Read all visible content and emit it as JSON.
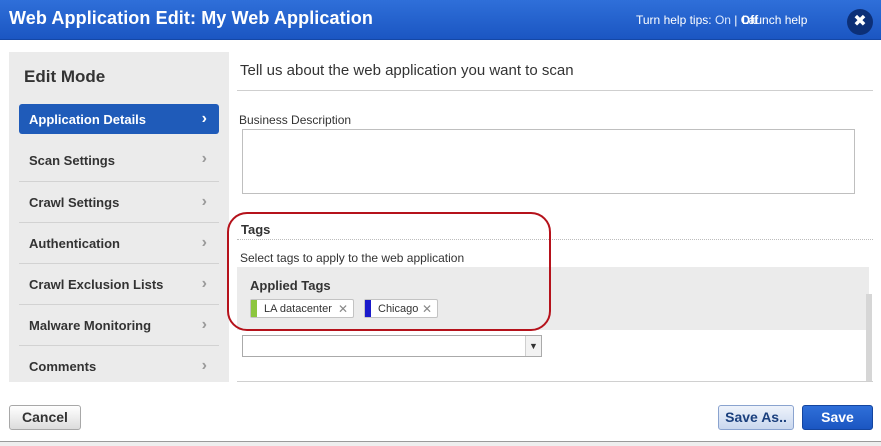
{
  "header": {
    "title": "Web Application Edit: My Web Application",
    "help_prefix": "Turn help tips: ",
    "help_on": "On",
    "help_sep": " | ",
    "help_off": "Off",
    "launch_help": "Launch help",
    "close_glyph": "✖"
  },
  "sidebar": {
    "mode_title": "Edit Mode",
    "items": [
      {
        "label": "Application Details",
        "active": true
      },
      {
        "label": "Scan Settings"
      },
      {
        "label": "Crawl Settings"
      },
      {
        "label": "Authentication"
      },
      {
        "label": "Crawl Exclusion Lists"
      },
      {
        "label": "Malware Monitoring"
      },
      {
        "label": "Comments"
      }
    ],
    "chevron_icon": "chevron-right-icon"
  },
  "main": {
    "heading": "Tell us about the web application you want to scan",
    "business_description_label": "Business Description",
    "business_description_value": "",
    "tags_title": "Tags",
    "tags_subtitle": "Select tags to apply to the web application",
    "applied_tags_title": "Applied Tags",
    "applied_tags": [
      {
        "label": "LA datacenter",
        "color": "#8dc63f"
      },
      {
        "label": "Chicago",
        "color": "#1a1acb"
      }
    ],
    "tag_select_value": "",
    "highlight_color": "#b5121b"
  },
  "footer": {
    "cancel": "Cancel",
    "save_as": "Save As..",
    "save": "Save"
  },
  "colors": {
    "header_blue": "#1b56c2",
    "active_nav": "#1f5bb9",
    "sidebar_bg": "#ebebeb"
  }
}
